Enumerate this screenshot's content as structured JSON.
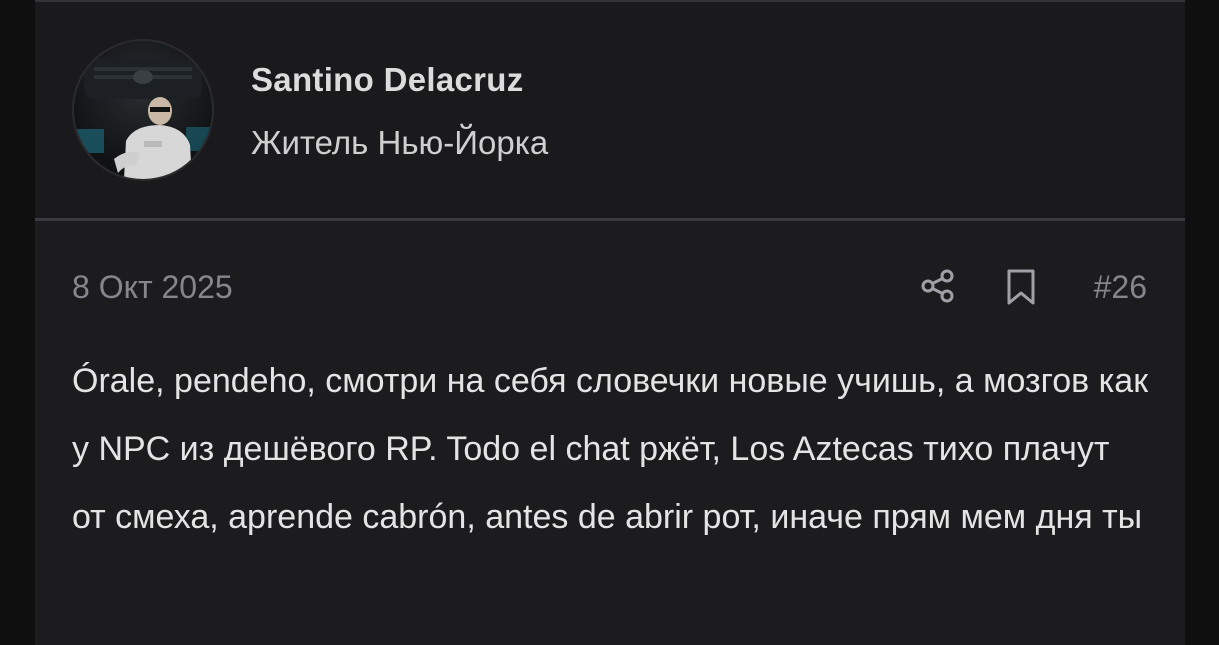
{
  "author": {
    "name": "Santino Delacruz",
    "title": "Житель Нью-Йорка",
    "avatar_icon": "character-avatar"
  },
  "post": {
    "date": "8 Окт 2025",
    "number": "#26",
    "share_icon": "share-icon",
    "bookmark_icon": "bookmark-icon",
    "body": "Órale, pendeho, смотри на себя словечки новые учишь, а мозгов как у NPC из дешёвого RP. Todo el chat ржёт, Los Aztecas тихо плачут от смеха, aprende cabrón, antes de abrir рот, иначе прям мем дня ты"
  },
  "colors": {
    "page_bg": "#0f0f10",
    "card_bg": "#1c1c1f",
    "divider": "#3a3a40",
    "muted_text": "#86868c",
    "body_text": "#e4e4e4"
  }
}
